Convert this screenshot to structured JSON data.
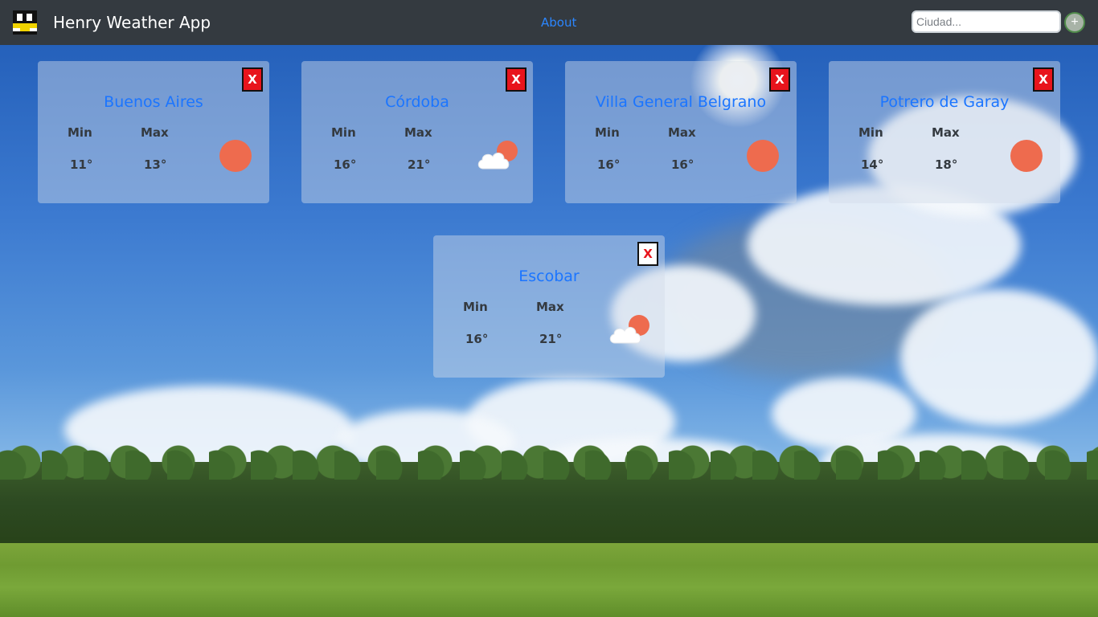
{
  "header": {
    "app_title": "Henry Weather App",
    "about_label": "About",
    "search_placeholder": "Ciudad...",
    "add_label": "+"
  },
  "labels": {
    "min": "Min",
    "max": "Max",
    "close": "X"
  },
  "cards": [
    {
      "city": "Buenos Aires",
      "min": "11°",
      "max": "13°",
      "icon": "sun-icon"
    },
    {
      "city": "Córdoba",
      "min": "16°",
      "max": "21°",
      "icon": "sun-behind-cloud-icon"
    },
    {
      "city": "Villa General Belgrano",
      "min": "16°",
      "max": "16°",
      "icon": "sun-icon"
    },
    {
      "city": "Potrero de Garay",
      "min": "14°",
      "max": "18°",
      "icon": "sun-icon"
    },
    {
      "city": "Escobar",
      "min": "16°",
      "max": "21°",
      "icon": "sun-behind-cloud-icon"
    }
  ],
  "colors": {
    "navbar": "#343a40",
    "link": "#1b75ff",
    "close_button": "#e8141c",
    "sun": "#ee6b4e"
  }
}
